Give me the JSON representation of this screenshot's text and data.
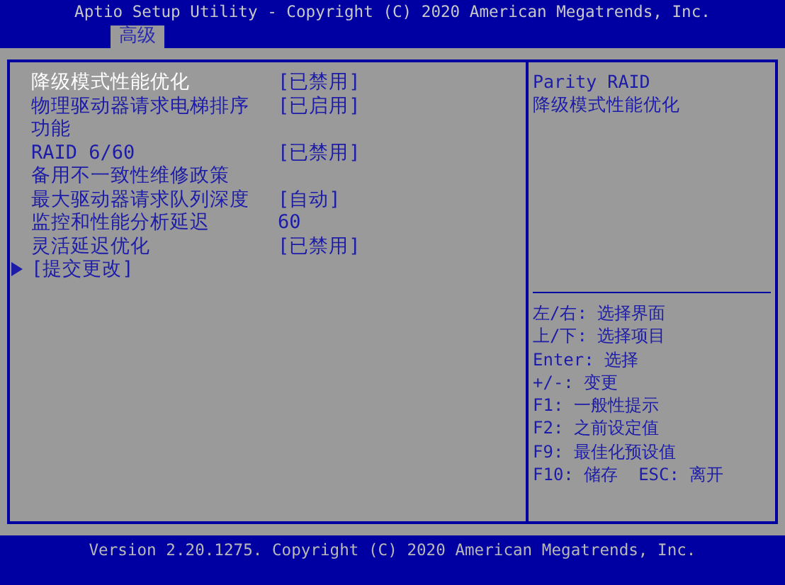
{
  "header": {
    "title": "Aptio Setup Utility - Copyright (C) 2020 American Megatrends, Inc.",
    "tabs": [
      {
        "label": "高级",
        "selected": true
      }
    ]
  },
  "items": [
    {
      "kind": "setting",
      "label": "降级模式性能优化",
      "value": "[已禁用]",
      "selected": true
    },
    {
      "kind": "setting",
      "label": "物理驱动器请求电梯排序功能",
      "value": "[已启用]",
      "selected": false
    },
    {
      "kind": "setting",
      "label": "RAID 6/60\n备用不一致性维修政策",
      "value": "[已禁用]",
      "selected": false
    },
    {
      "kind": "setting",
      "label": "最大驱动器请求队列深度",
      "value": "[自动]",
      "selected": false
    },
    {
      "kind": "setting",
      "label": "监控和性能分析延迟",
      "value": "60",
      "selected": false
    },
    {
      "kind": "setting",
      "label": "灵活延迟优化",
      "value": "[已禁用]",
      "selected": false
    },
    {
      "kind": "submenu",
      "label": "[提交更改]",
      "selected": false
    }
  ],
  "help": {
    "text": "Parity RAID\n降级模式性能优化",
    "keys": [
      "左/右: 选择界面",
      "上/下: 选择项目",
      "Enter: 选择",
      "+/-: 变更",
      "F1: 一般性提示",
      "F2: 之前设定值",
      "F9: 最佳化预设值",
      "F10: 储存  ESC: 离开"
    ]
  },
  "footer": "Version 2.20.1275. Copyright (C) 2020 American Megatrends, Inc."
}
